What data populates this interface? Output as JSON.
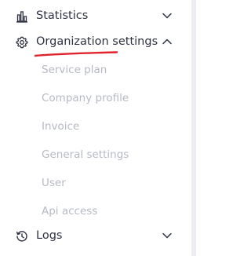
{
  "sidebar": {
    "items": [
      {
        "label": "Statistics",
        "icon": "bar-chart-icon",
        "expanded": false
      },
      {
        "label": "Organization settings",
        "icon": "gear-icon",
        "expanded": true
      },
      {
        "label": "Logs",
        "icon": "history-icon",
        "expanded": false
      }
    ],
    "submenu": [
      {
        "label": "Service plan"
      },
      {
        "label": "Company profile"
      },
      {
        "label": "Invoice"
      },
      {
        "label": "General settings"
      },
      {
        "label": "User"
      },
      {
        "label": "Api access"
      }
    ]
  },
  "colors": {
    "text": "#2e3142",
    "submenu_text": "#b7bac4",
    "annotation_underline": "#e0242e",
    "scroll_edge": "#eceef1"
  }
}
